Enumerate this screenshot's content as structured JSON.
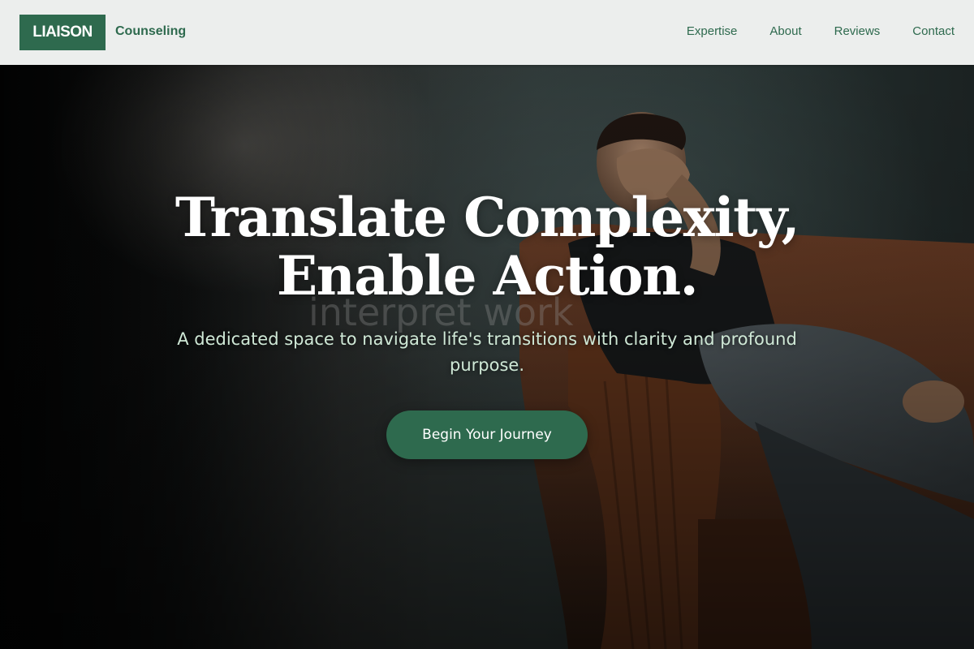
{
  "header": {
    "logo_text": "LIAISON",
    "logo_subtitle": "Counseling",
    "nav_items": [
      "Expertise",
      "About",
      "Reviews",
      "Contact"
    ]
  },
  "hero": {
    "headline_line1": "Translate Complexity,",
    "headline_line2": "Enable Action.",
    "ghost_text": "interpret work",
    "subheadline": "A dedicated space to navigate life's transitions with clarity and profound purpose.",
    "cta_label": "Begin Your Journey",
    "image_subject": "man seated in a brown leather armchair, hand over face"
  },
  "colors": {
    "brand_green": "#2e6a4e",
    "header_bg": "#eceeed",
    "subheadline": "#cfe8d6",
    "headline": "#ffffff"
  }
}
